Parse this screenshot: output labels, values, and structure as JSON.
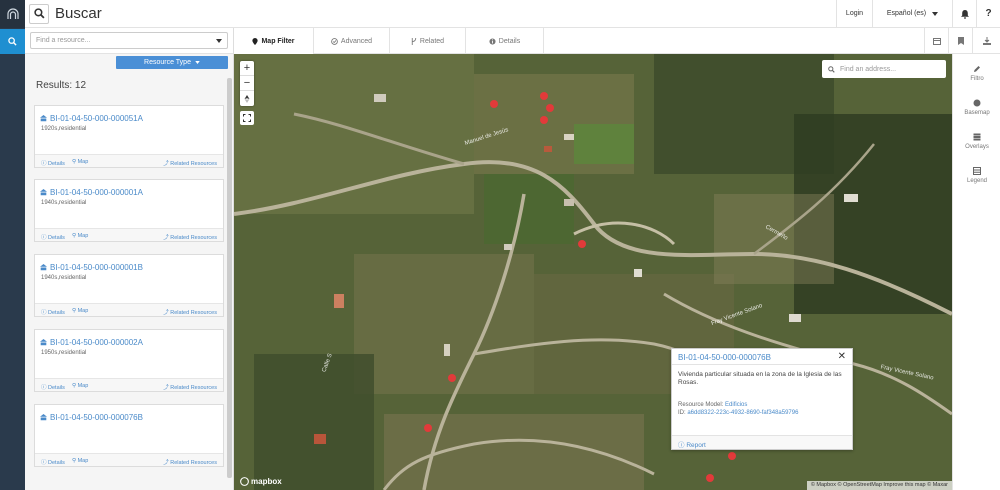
{
  "topbar": {
    "title": "Buscar",
    "login": "Login",
    "language": "Español (es)",
    "help": "?"
  },
  "search": {
    "placeholder": "Find a resource..."
  },
  "resource_type_label": "Resource Type",
  "results_label": "Results: 12",
  "cards": [
    {
      "id": "BI-01-04-50-000-000051A",
      "desc": "1920s,residential",
      "details": "Details",
      "map": "Map",
      "related": "Related Resources"
    },
    {
      "id": "BI-01-04-50-000-000001A",
      "desc": "1940s,residential",
      "details": "Details",
      "map": "Map",
      "related": "Related Resources"
    },
    {
      "id": "BI-01-04-50-000-000001B",
      "desc": "1940s,residential",
      "details": "Details",
      "map": "Map",
      "related": "Related Resources"
    },
    {
      "id": "BI-01-04-50-000-000002A",
      "desc": "1950s,residential",
      "details": "Details",
      "map": "Map",
      "related": "Related Resources"
    },
    {
      "id": "BI-01-04-50-000-000076B",
      "desc": "",
      "details": "Details",
      "map": "Map",
      "related": "Related Resources"
    }
  ],
  "tabs": [
    "Map Filter",
    "Advanced",
    "Related",
    "Details"
  ],
  "map": {
    "address_placeholder": "Find an address...",
    "zoom_in": "+",
    "zoom_out": "−",
    "mapbox": "mapbox",
    "attribution": "© Mapbox © OpenStreetMap Improve this map © Maxar",
    "road_labels": [
      "Manuel de Jesús",
      "Fray Vicente Solano",
      "Fray Vicente Solano",
      "Cermeño",
      "Calle S"
    ]
  },
  "popup": {
    "title": "BI-01-04-50-000-000076B",
    "description": "Vivienda particular situada en la zona de la Iglesia de las Rosas.",
    "model_label": "Resource Model:",
    "model_value": "Edificios",
    "id_label": "ID:",
    "id_value": "a6dd8322-223c-4932-8690-faf348a59796",
    "report": "Report"
  },
  "right_sidebar": [
    "Filtro",
    "Basemap",
    "Overlays",
    "Legend"
  ],
  "colors": {
    "accent": "#4a8fd6",
    "rail": "#2a3a4c",
    "marker": "#e23a3a"
  }
}
